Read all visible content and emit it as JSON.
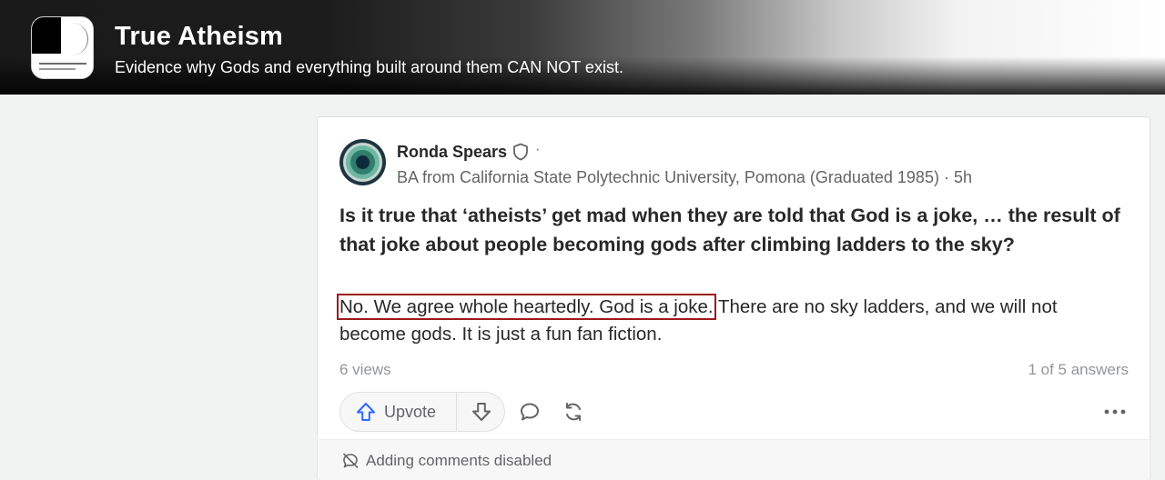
{
  "space": {
    "title": "True Atheism",
    "description": "Evidence why Gods and everything built around them CAN NOT exist."
  },
  "post": {
    "author": "Ronda Spears",
    "separator": "·",
    "credential": "BA from California State Polytechnic University, Pomona (Graduated 1985) · 5h",
    "question": "Is it true that ‘atheists’ get mad when they are told that God is a joke, … the result of that joke about people becoming gods after climbing ladders to the sky?",
    "answer_highlighted": "No. We agree whole heartedly. God is a joke.",
    "answer_rest": " There are no sky ladders, and we will not become gods. It is just a fun fan fiction.",
    "views": "6 views",
    "answers_count": "1 of 5 answers"
  },
  "actions": {
    "upvote_label": "Upvote",
    "comments_disabled": "Adding comments disabled"
  },
  "colors": {
    "highlight_outline": "#9c1b1b",
    "text_primary": "#282829",
    "text_secondary": "#636466"
  }
}
